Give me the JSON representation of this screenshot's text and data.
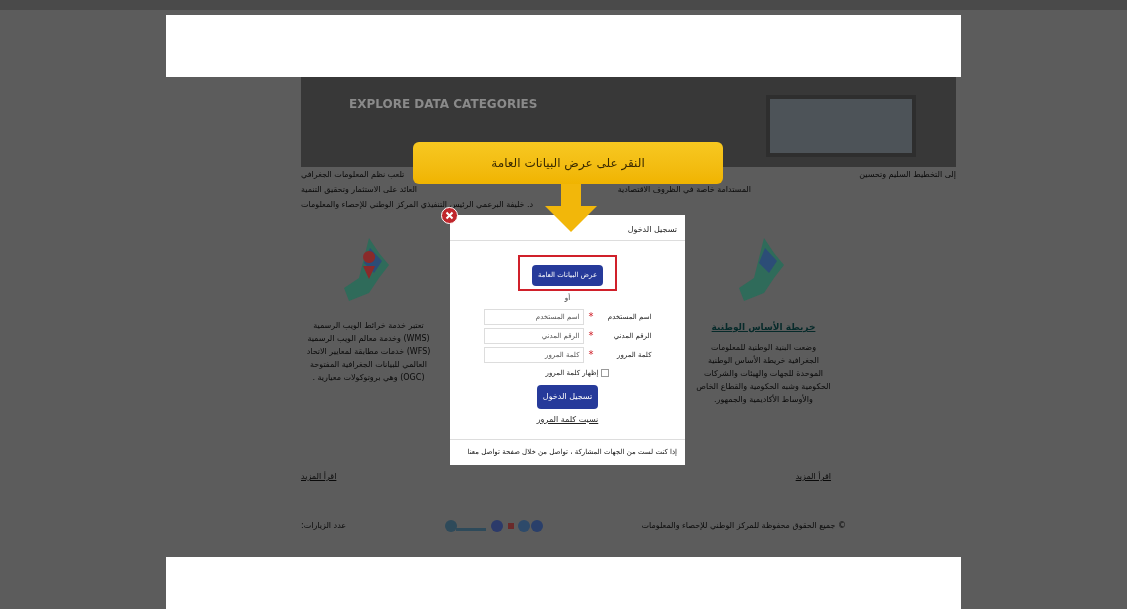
{
  "banner": {
    "title": "EXPLORE DATA CATEGORIES"
  },
  "intro": {
    "lines": [
      {
        "left": "تلعب نظم المعلومات الجغرافي",
        "right": "إلى التخطيط السليم وتحسين"
      },
      {
        "left": "العائد على الاستثمار وتحقيق التنمية",
        "right": "المستدامة خاصة في الظروف الاقتصادية"
      },
      {
        "left": "د. خليفة البرعمي الرئيس التنفيذي المركز الوطني للإحصاء والمعلومات"
      }
    ]
  },
  "cards": [
    {
      "title": "خريطة الأساس الوطنية",
      "text": "وضعت البنية الوطنية للمعلومات الجغرافية خريطة الأساس الوطنية الموحدة للجهات والهيئات والشركات الحكومية وشبه الحكومية والقطاع الخاص والأوساط الأكاديمية والجمهور.",
      "link": "اقرأ المزيد",
      "pin": false
    },
    {
      "text": "تعتبر خدمة خرائط الويب الرسمية (WMS) وخدمة معالم الويب الرسمية (WFS) خدمات مطابقة لمعايير الاتحاد العالمي للبيانات الجغرافية المفتوحة (OGC) وهي بروتوكولات معيارية .",
      "link": "اقرأ المزيد",
      "pin": true
    }
  ],
  "footer": {
    "copyright": "© جميع الحقوق محفوظة للمركز الوطني للإحصاء والمعلومات",
    "visits": "عدد الزيارات:"
  },
  "callout": {
    "text": "النقر على عرض البيانات العامة"
  },
  "modal": {
    "title": "تسجيل الدخول",
    "public_button": "عرض البيانات العامة",
    "public_button_highlighted": true,
    "or": "أو",
    "required_mark": "*",
    "fields": [
      {
        "label": "اسم المستخدم",
        "required": true,
        "placeholder": "اسم المستخدم"
      },
      {
        "label": "الرقم المدني",
        "required": true,
        "placeholder": "الرقم المدني"
      },
      {
        "label": "كلمة المرور",
        "required": true,
        "placeholder": "كلمة المرور"
      }
    ],
    "show_password": {
      "label": "إظهار كلمة المرور",
      "checked": false
    },
    "login_button": "تسجيل الدخول",
    "forgot_link": "نسيت كلمة المرور",
    "note": "إذا كنت لست من الجهات المشاركة ، تواصل من خلال صفحة تواصل معنا"
  }
}
